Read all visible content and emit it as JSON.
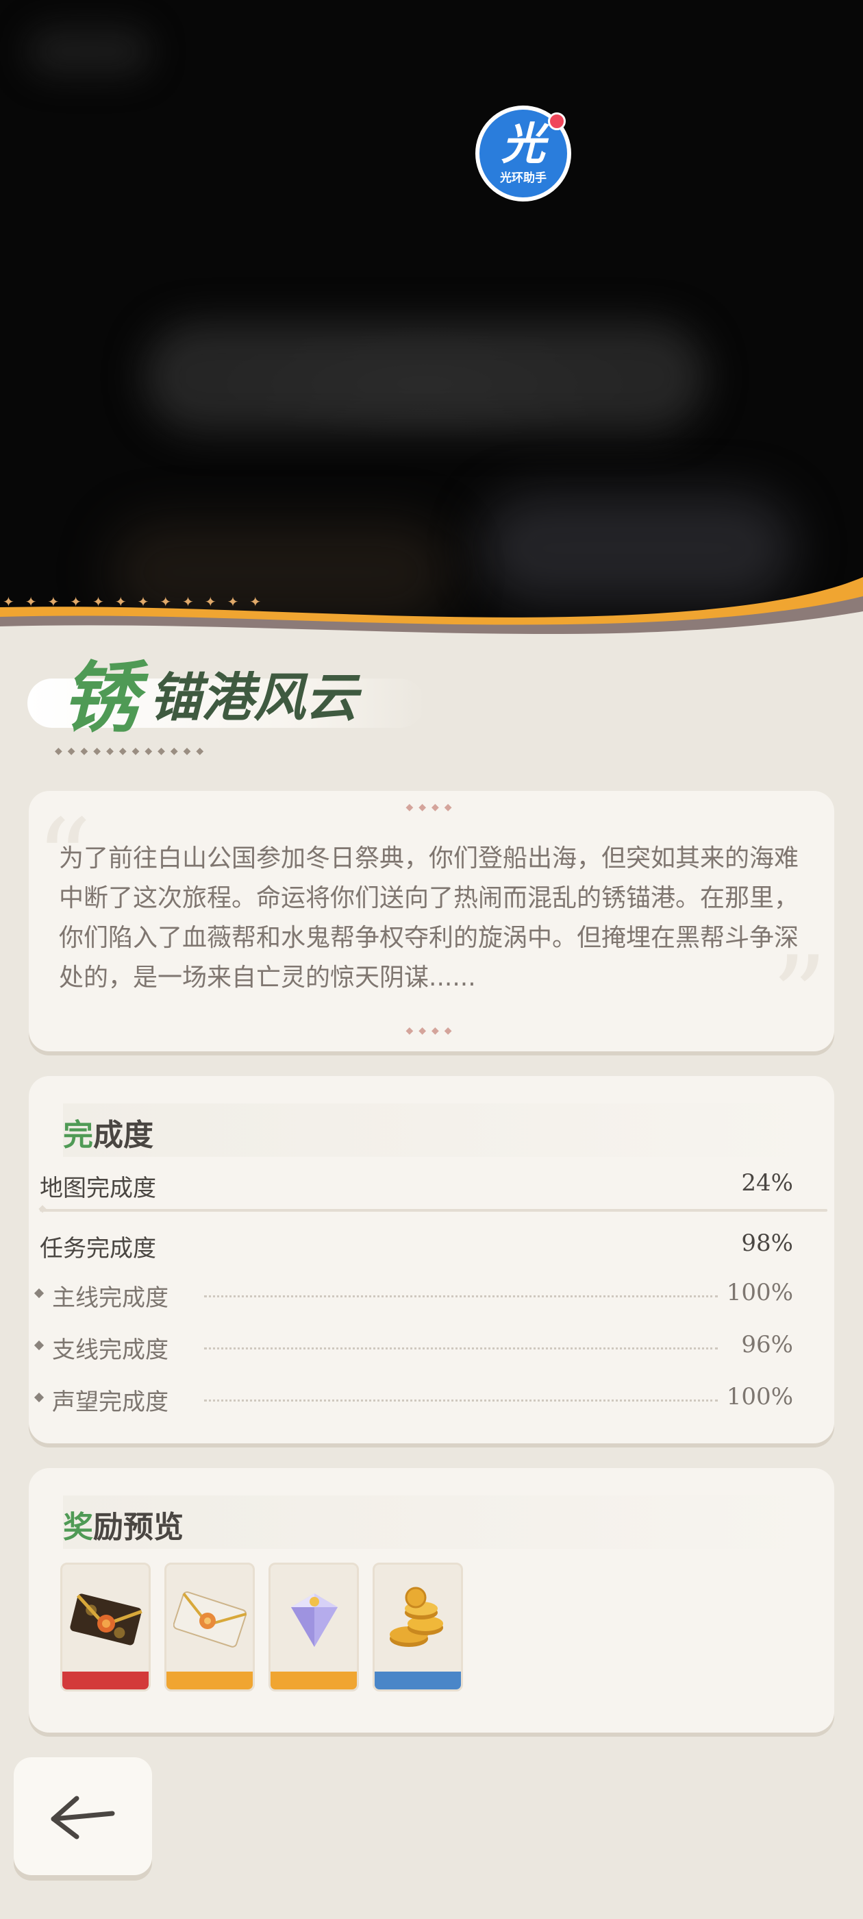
{
  "app_logo": {
    "glyph": "光",
    "name": "光环助手"
  },
  "title": {
    "first_char": "锈",
    "rest": "锚港风云"
  },
  "description": "为了前往白山公国参加冬日祭典，你们登船出海，但突如其来的海难中断了这次旅程。命运将你们送向了热闹而混乱的锈锚港。在那里，你们陷入了血薇帮和水鬼帮争权夺利的旋涡中。但掩埋在黑帮斗争深处的，是一场来自亡灵的惊天阴谋......",
  "completion": {
    "heading_accent": "完",
    "heading_rest": "成度",
    "map": {
      "label": "地图完成度",
      "value": "24%"
    },
    "quest": {
      "label": "任务完成度",
      "value": "98%"
    },
    "sub": [
      {
        "label": "主线完成度",
        "value": "100%"
      },
      {
        "label": "支线完成度",
        "value": "96%"
      },
      {
        "label": "声望完成度",
        "value": "100%"
      }
    ]
  },
  "rewards": {
    "heading_accent": "奖",
    "heading_rest": "励预览",
    "items": [
      {
        "icon": "dark-envelope-icon",
        "rarity_color": "#d33a3a"
      },
      {
        "icon": "white-envelope-icon",
        "rarity_color": "#f0a531"
      },
      {
        "icon": "crystal-gem-icon",
        "rarity_color": "#f0a531"
      },
      {
        "icon": "gold-coins-icon",
        "rarity_color": "#4a86c8"
      }
    ]
  },
  "colors": {
    "accent_green": "#4f9a55",
    "wave_orange": "#f0a531"
  }
}
